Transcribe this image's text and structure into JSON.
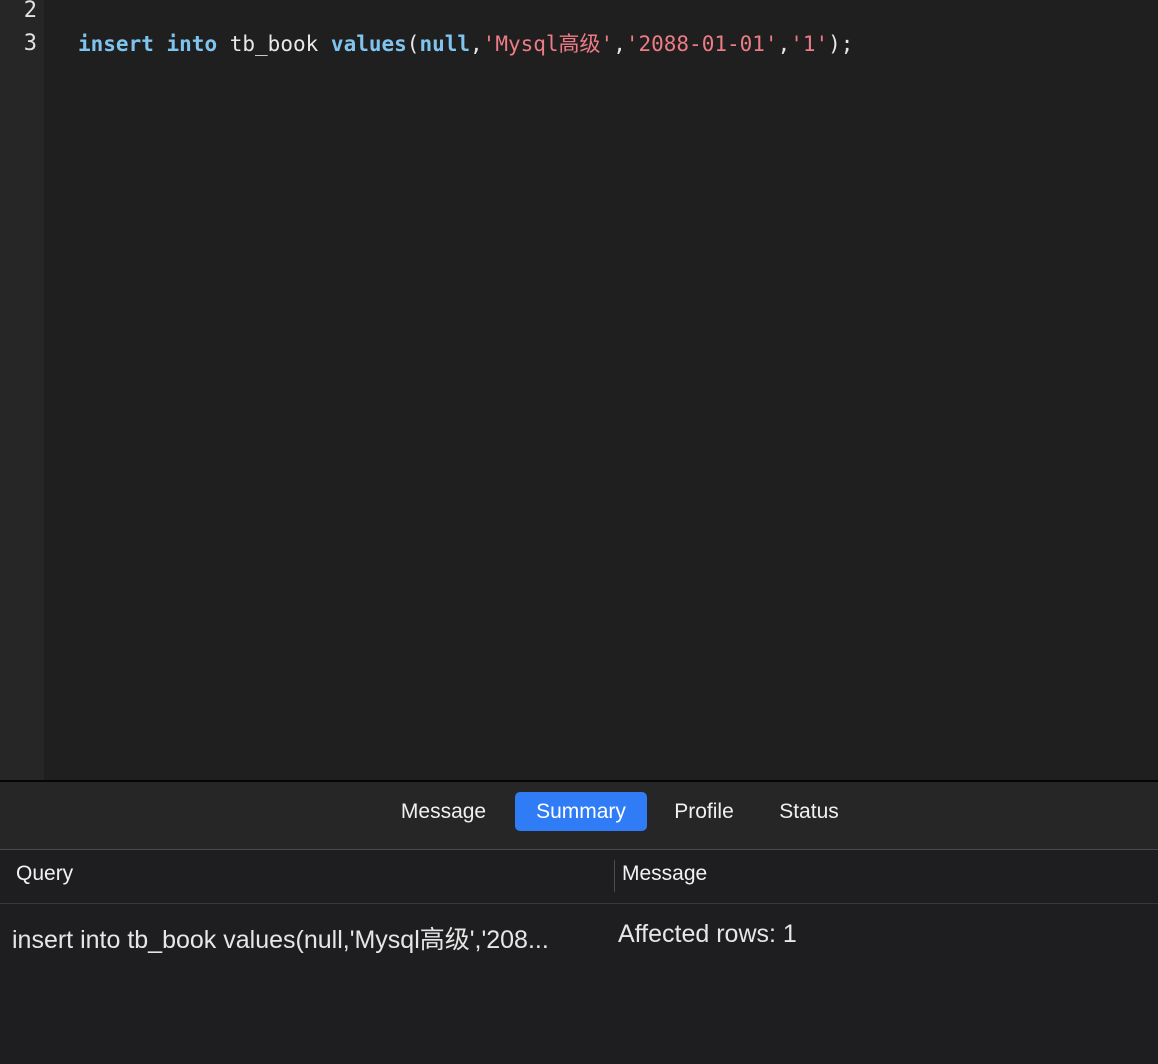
{
  "editor": {
    "line_numbers": [
      "2",
      "3"
    ],
    "code": {
      "kw_insert": "insert",
      "kw_into": "into",
      "table": "tb_book",
      "kw_values": "values",
      "open_paren": "(",
      "kw_null": "null",
      "comma1": ",",
      "str1": "'Mysql高级'",
      "comma2": ",",
      "str2": "'2088-01-01'",
      "comma3": ",",
      "str3": "'1'",
      "close": ");"
    }
  },
  "tabs": [
    {
      "label": "Message",
      "active": false
    },
    {
      "label": "Summary",
      "active": true
    },
    {
      "label": "Profile",
      "active": false
    },
    {
      "label": "Status",
      "active": false
    }
  ],
  "results": {
    "columns": [
      "Query",
      "Message"
    ],
    "rows": [
      {
        "query": "insert into tb_book values(null,'Mysql高级','208...",
        "message": "Affected rows: 1"
      }
    ]
  },
  "colors": {
    "keyword": "#7fc4ee",
    "string": "#ee7c86",
    "active_tab": "#2f7cf6"
  }
}
